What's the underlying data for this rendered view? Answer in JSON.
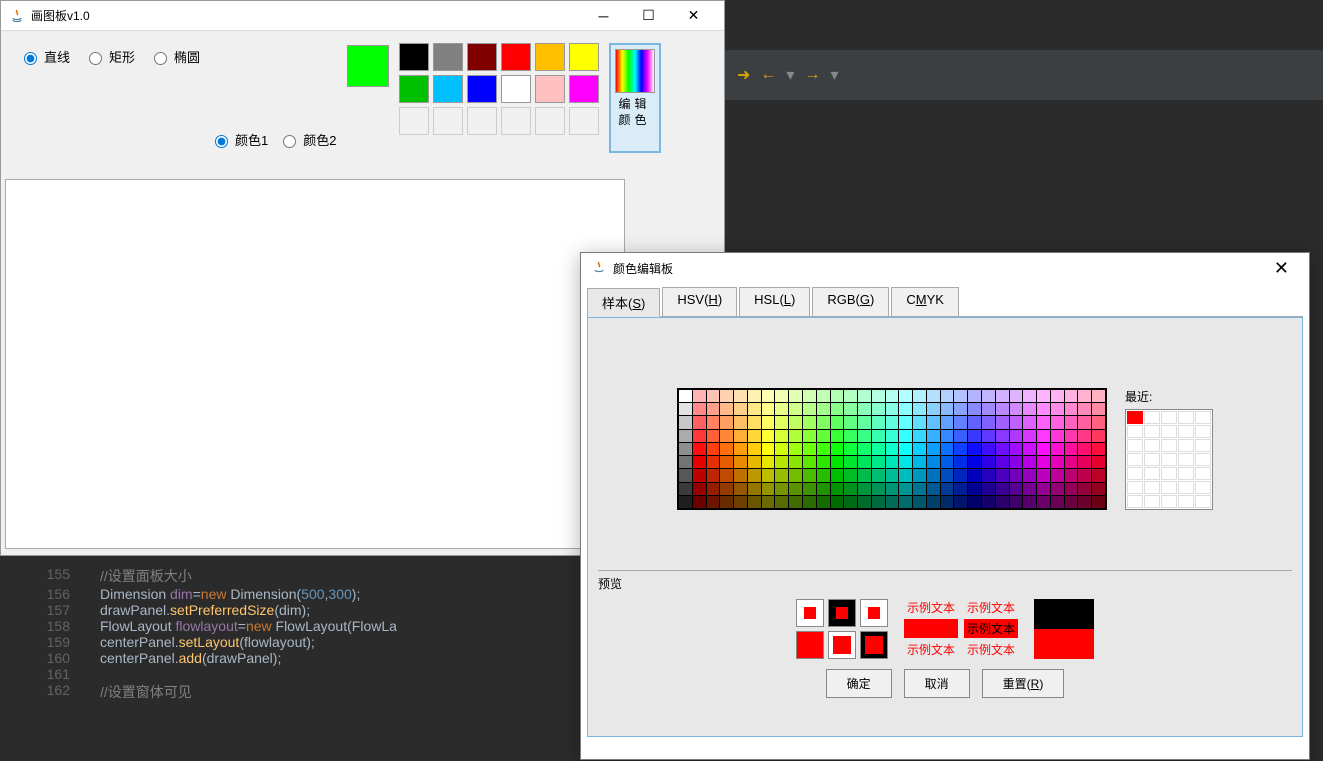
{
  "paintWindow": {
    "title": "画图板v1.0",
    "shapes": {
      "line": "直线",
      "rect": "矩形",
      "oval": "椭圆"
    },
    "colorLabels": {
      "c1": "颜色1",
      "c2": "颜色2"
    },
    "editColorBtn": "编辑颜色",
    "basicColors": {
      "row1": [
        "#000000",
        "#808080",
        "#800000",
        "#ff0000",
        "#ffc000",
        "#ffff00"
      ],
      "row2": [
        "#00c000",
        "#00c0ff",
        "#0000ff",
        "#ffffff",
        "#ffc0c0",
        "#ff00ff"
      ]
    },
    "currentColor": "#00ff00"
  },
  "colorDialog": {
    "title": "颜色编辑板",
    "tabs": {
      "swatch": "样本(S)",
      "hsv": "HSV(H)",
      "hsl": "HSL(L)",
      "rgb": "RGB(G)",
      "cmyk": "CMYK"
    },
    "recentLabel": "最近:",
    "previewLabel": "预览",
    "sampleText": "示例文本",
    "buttons": {
      "ok": "确定",
      "cancel": "取消",
      "reset": "重置(R)"
    },
    "selectedColor": "#ff0000"
  },
  "code": {
    "lines": [
      {
        "n": "155",
        "t": "//设置面板大小"
      },
      {
        "n": "156",
        "t": "Dimension dim=new Dimension(500,300);"
      },
      {
        "n": "157",
        "t": "drawPanel.setPreferredSize(dim);"
      },
      {
        "n": "158",
        "t": "FlowLayout flowlayout=new FlowLayout(FlowLa"
      },
      {
        "n": "159",
        "t": "centerPanel.setLayout(flowlayout);"
      },
      {
        "n": "160",
        "t": "centerPanel.add(drawPanel);"
      },
      {
        "n": "161",
        "t": ""
      },
      {
        "n": "162",
        "t": "//设置窗体可见"
      }
    ]
  }
}
